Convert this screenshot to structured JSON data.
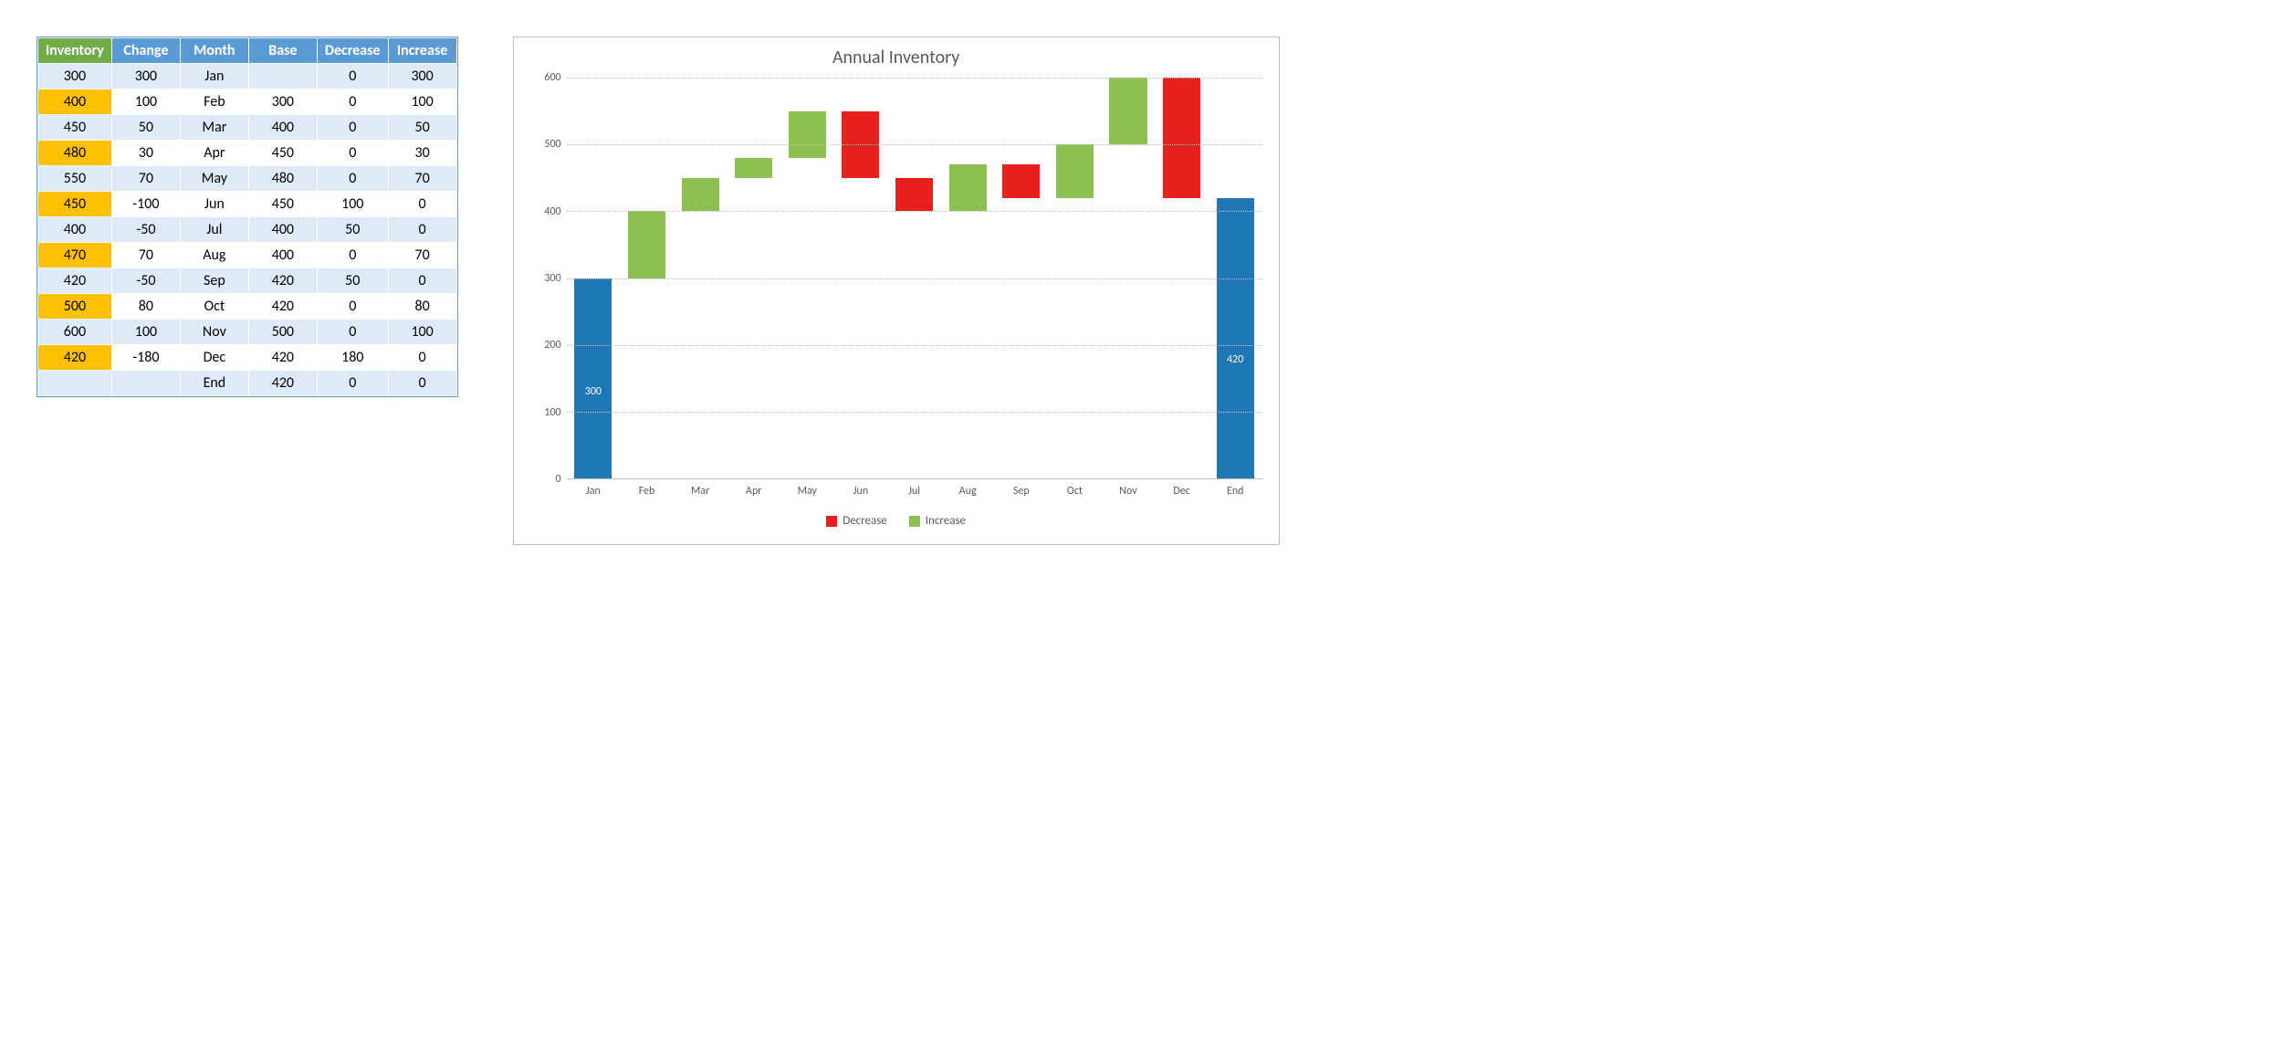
{
  "table": {
    "headers": [
      "Inventory",
      "Change",
      "Month",
      "Base",
      "Decrease",
      "Increase"
    ],
    "rows": [
      {
        "inventory": "300",
        "change": "300",
        "month": "Jan",
        "base": "",
        "decrease": "0",
        "increase": "300"
      },
      {
        "inventory": "400",
        "change": "100",
        "month": "Feb",
        "base": "300",
        "decrease": "0",
        "increase": "100"
      },
      {
        "inventory": "450",
        "change": "50",
        "month": "Mar",
        "base": "400",
        "decrease": "0",
        "increase": "50"
      },
      {
        "inventory": "480",
        "change": "30",
        "month": "Apr",
        "base": "450",
        "decrease": "0",
        "increase": "30"
      },
      {
        "inventory": "550",
        "change": "70",
        "month": "May",
        "base": "480",
        "decrease": "0",
        "increase": "70"
      },
      {
        "inventory": "450",
        "change": "-100",
        "month": "Jun",
        "base": "450",
        "decrease": "100",
        "increase": "0"
      },
      {
        "inventory": "400",
        "change": "-50",
        "month": "Jul",
        "base": "400",
        "decrease": "50",
        "increase": "0"
      },
      {
        "inventory": "470",
        "change": "70",
        "month": "Aug",
        "base": "400",
        "decrease": "0",
        "increase": "70"
      },
      {
        "inventory": "420",
        "change": "-50",
        "month": "Sep",
        "base": "420",
        "decrease": "50",
        "increase": "0"
      },
      {
        "inventory": "500",
        "change": "80",
        "month": "Oct",
        "base": "420",
        "decrease": "0",
        "increase": "80"
      },
      {
        "inventory": "600",
        "change": "100",
        "month": "Nov",
        "base": "500",
        "decrease": "0",
        "increase": "100"
      },
      {
        "inventory": "420",
        "change": "-180",
        "month": "Dec",
        "base": "420",
        "decrease": "180",
        "increase": "0"
      },
      {
        "inventory": "",
        "change": "",
        "month": "End",
        "base": "420",
        "decrease": "0",
        "increase": "0",
        "end": true
      }
    ]
  },
  "chart_data": {
    "type": "bar",
    "title": "Annual Inventory",
    "ylim": [
      0,
      600
    ],
    "yticks": [
      0,
      100,
      200,
      300,
      400,
      500,
      600
    ],
    "categories": [
      "Jan",
      "Feb",
      "Mar",
      "Apr",
      "May",
      "Jun",
      "Jul",
      "Aug",
      "Sep",
      "Oct",
      "Nov",
      "Dec",
      "End"
    ],
    "bars": [
      {
        "category": "Jan",
        "kind": "total",
        "base": 0,
        "value": 300,
        "label": "300"
      },
      {
        "category": "Feb",
        "kind": "increase",
        "base": 300,
        "value": 100
      },
      {
        "category": "Mar",
        "kind": "increase",
        "base": 400,
        "value": 50
      },
      {
        "category": "Apr",
        "kind": "increase",
        "base": 450,
        "value": 30
      },
      {
        "category": "May",
        "kind": "increase",
        "base": 480,
        "value": 70
      },
      {
        "category": "Jun",
        "kind": "decrease",
        "base": 450,
        "value": 100
      },
      {
        "category": "Jul",
        "kind": "decrease",
        "base": 400,
        "value": 50
      },
      {
        "category": "Aug",
        "kind": "increase",
        "base": 400,
        "value": 70
      },
      {
        "category": "Sep",
        "kind": "decrease",
        "base": 420,
        "value": 50
      },
      {
        "category": "Oct",
        "kind": "increase",
        "base": 420,
        "value": 80
      },
      {
        "category": "Nov",
        "kind": "increase",
        "base": 500,
        "value": 100
      },
      {
        "category": "Dec",
        "kind": "decrease",
        "base": 420,
        "value": 180
      },
      {
        "category": "End",
        "kind": "total",
        "base": 0,
        "value": 420,
        "label": "420"
      }
    ],
    "legend": [
      {
        "name": "Decrease",
        "color": "#e7201e"
      },
      {
        "name": "Increase",
        "color": "#8cc152"
      }
    ]
  }
}
